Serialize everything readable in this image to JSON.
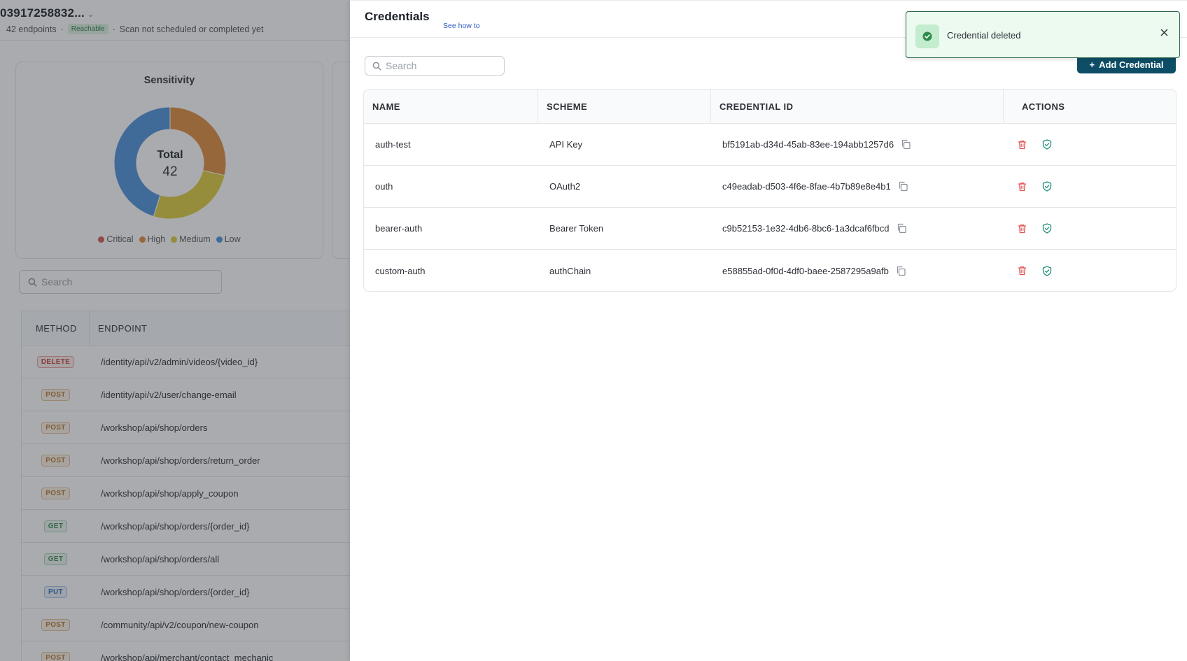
{
  "project": {
    "title": "03917258832...",
    "endpoint_count": "42 endpoints",
    "status_badge": "Reachable",
    "scan_status": "Scan not scheduled or completed yet"
  },
  "sensitivity": {
    "title": "Sensitivity",
    "total_label": "Total",
    "total_value": "42",
    "legend": [
      {
        "label": "Critical",
        "color": "#d9534f"
      },
      {
        "label": "High",
        "color": "#e08a3c"
      },
      {
        "label": "Medium",
        "color": "#dccb3a"
      },
      {
        "label": "Low",
        "color": "#4a8fd9"
      }
    ],
    "chart_data": {
      "type": "pie",
      "categories": [
        "Critical",
        "High",
        "Medium",
        "Low"
      ],
      "values": [
        0,
        12,
        11,
        19
      ]
    }
  },
  "endpoint_search": {
    "placeholder": "Search"
  },
  "endpoint_table": {
    "headers": [
      "METHOD",
      "ENDPOINT"
    ],
    "rows": [
      {
        "method": "DELETE",
        "path": "/identity/api/v2/admin/videos/{video_id}"
      },
      {
        "method": "POST",
        "path": "/identity/api/v2/user/change-email"
      },
      {
        "method": "POST",
        "path": "/workshop/api/shop/orders"
      },
      {
        "method": "POST",
        "path": "/workshop/api/shop/orders/return_order"
      },
      {
        "method": "POST",
        "path": "/workshop/api/shop/apply_coupon"
      },
      {
        "method": "GET",
        "path": "/workshop/api/shop/orders/{order_id}"
      },
      {
        "method": "GET",
        "path": "/workshop/api/shop/orders/all"
      },
      {
        "method": "PUT",
        "path": "/workshop/api/shop/orders/{order_id}"
      },
      {
        "method": "POST",
        "path": "/community/api/v2/coupon/new-coupon"
      },
      {
        "method": "POST",
        "path": "/workshop/api/merchant/contact_mechanic"
      }
    ]
  },
  "drawer": {
    "title": "Credentials",
    "see_how": "See how to",
    "search_placeholder": "Search",
    "add_button": "Add Credential",
    "table": {
      "headers": [
        "NAME",
        "SCHEME",
        "CREDENTIAL ID",
        "ACTIONS"
      ],
      "rows": [
        {
          "name": "auth-test",
          "scheme": "API Key",
          "id": "bf5191ab-d34d-45ab-83ee-194abb1257d6"
        },
        {
          "name": "outh",
          "scheme": "OAuth2",
          "id": "c49eadab-d503-4f6e-8fae-4b7b89e8e4b1"
        },
        {
          "name": "bearer-auth",
          "scheme": "Bearer Token",
          "id": "c9b52153-1e32-4db6-8bc6-1a3dcaf6fbcd"
        },
        {
          "name": "custom-auth",
          "scheme": "authChain",
          "id": "e58855ad-0f0d-4df0-baee-2587295a9afb"
        }
      ]
    }
  },
  "toast": {
    "message": "Credential deleted"
  },
  "colors": {
    "accent": "#0d4e66",
    "delete": "#e05252",
    "verify": "#1f8f7a",
    "link": "#2a57c6",
    "toast_border": "#2f6a49",
    "toast_bg": "#ecfaf0"
  }
}
